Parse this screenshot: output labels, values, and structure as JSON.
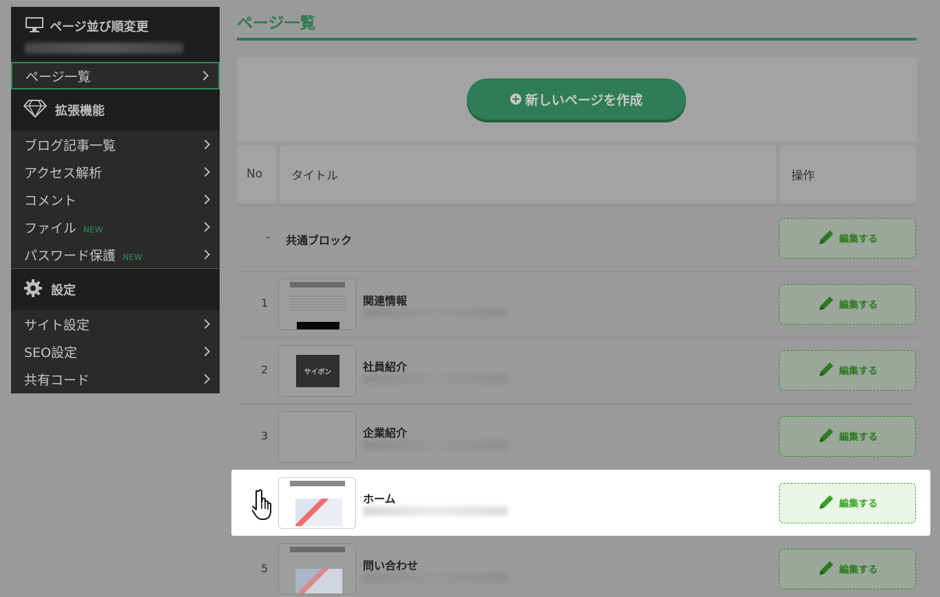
{
  "sidebar": {
    "header_title": "ページ並び順変更",
    "header_icon": "monitor-icon",
    "items_main": [
      {
        "label": "ページ一覧",
        "active": true
      }
    ],
    "section_extend": "拡張機能",
    "items_extend": [
      {
        "label": "ブログ記事一覧",
        "badge": ""
      },
      {
        "label": "アクセス解析",
        "badge": ""
      },
      {
        "label": "コメント",
        "badge": ""
      },
      {
        "label": "ファイル",
        "badge": "NEW"
      },
      {
        "label": "パスワード保護",
        "badge": "NEW"
      }
    ],
    "section_settings": "設定",
    "items_settings": [
      {
        "label": "サイト設定"
      },
      {
        "label": "SEO設定"
      },
      {
        "label": "共有コード"
      }
    ]
  },
  "main": {
    "title": "ページ一覧",
    "create_button": "新しいページを作成",
    "columns": {
      "no": "No",
      "title": "タイトル",
      "op": "操作"
    },
    "edit_label": "編集する",
    "rows": [
      {
        "no": "-",
        "name": "共通ブロック"
      },
      {
        "no": "1",
        "name": "関連情報"
      },
      {
        "no": "2",
        "name": "社員紹介",
        "thumb_text": "サイボン"
      },
      {
        "no": "3",
        "name": "企業紹介"
      },
      {
        "no": "",
        "name": "ホーム"
      },
      {
        "no": "5",
        "name": "問い合わせ"
      }
    ]
  },
  "colors": {
    "accent": "#2f7a4f",
    "edit_green": "#39a32a",
    "overlay": "#9a9a9a"
  }
}
